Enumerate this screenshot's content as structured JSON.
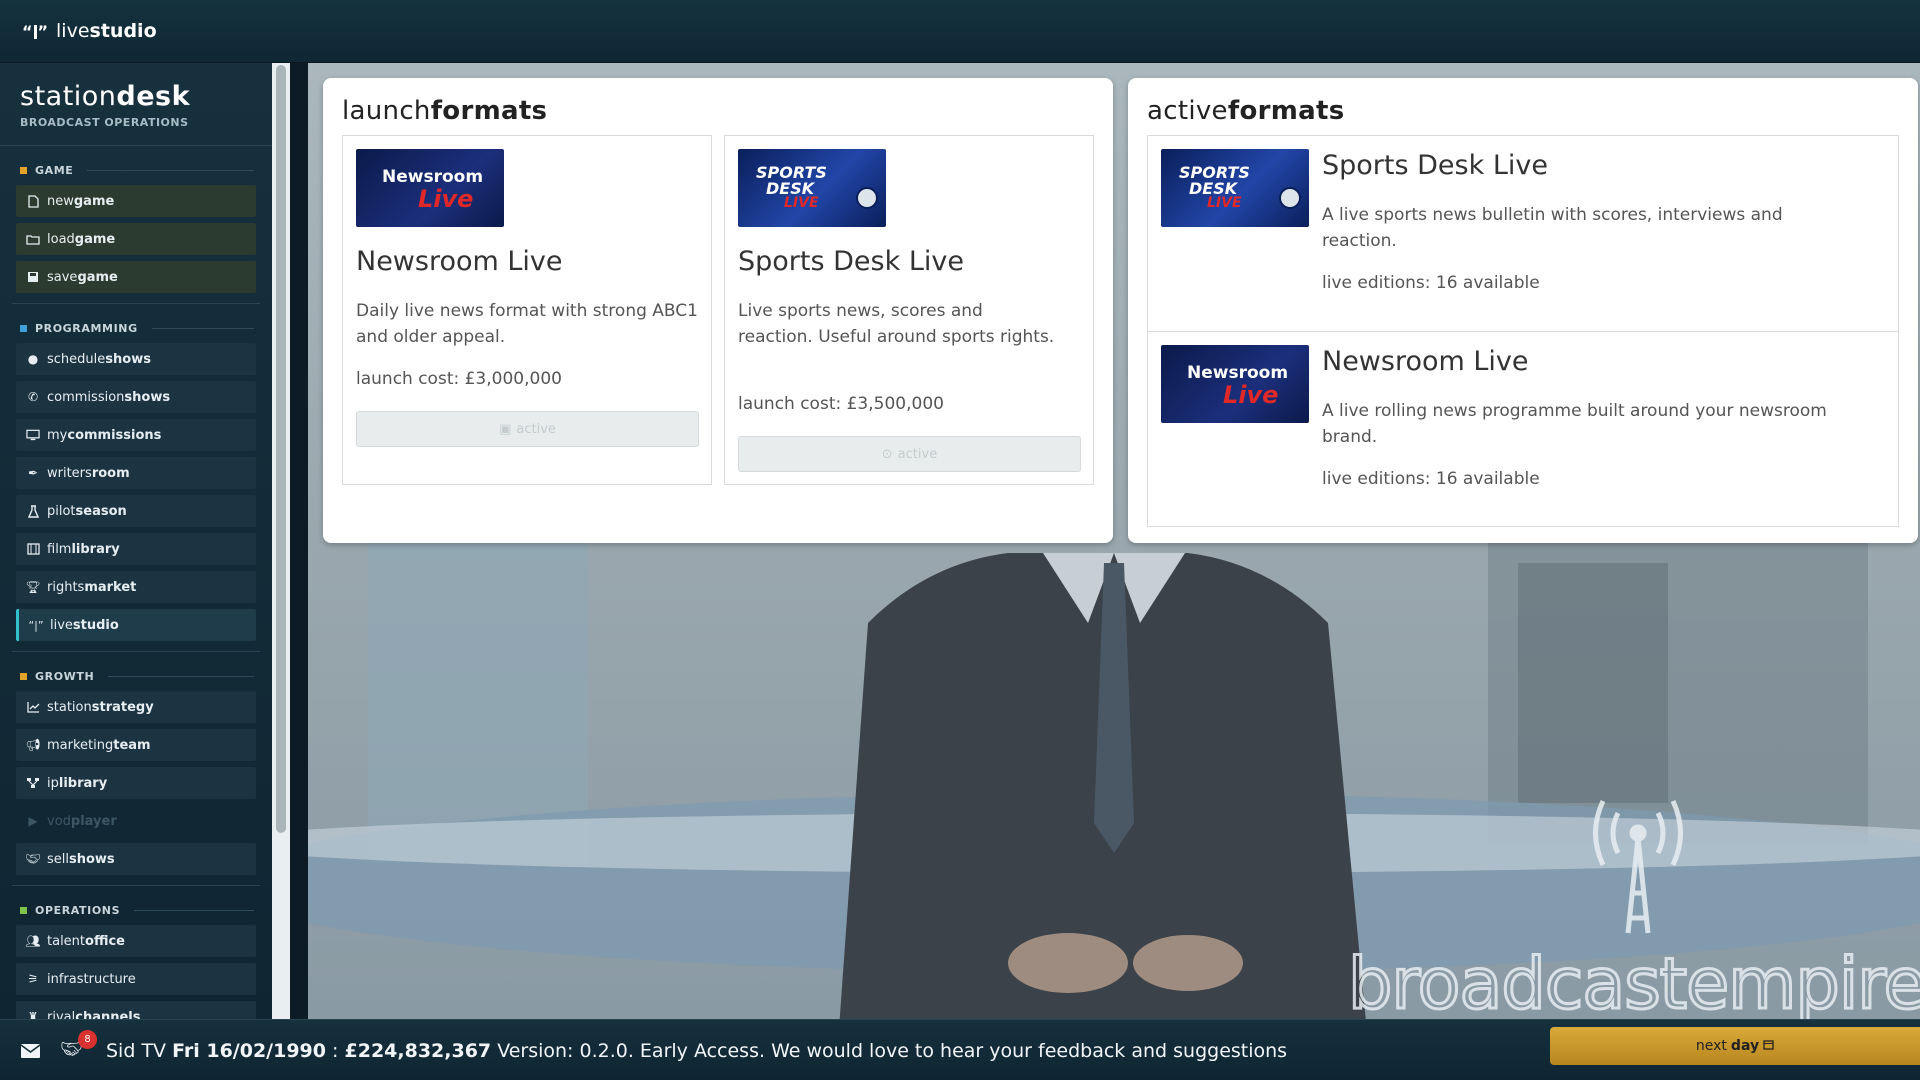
{
  "topbar": {
    "title_light": "live",
    "title_bold": "studio",
    "icon": "antenna-icon"
  },
  "sidebar": {
    "brand_light": "station",
    "brand_bold": "desk",
    "brand_sub": "BROADCAST OPERATIONS",
    "sections": [
      {
        "title": "GAME",
        "color": "#e2a32a",
        "items": [
          {
            "light": "new",
            "bold": "game",
            "icon": "file-icon"
          },
          {
            "light": "load",
            "bold": "game",
            "icon": "folder-icon"
          },
          {
            "light": "save",
            "bold": "game",
            "icon": "floppy-icon"
          }
        ]
      },
      {
        "title": "PROGRAMMING",
        "color": "#3fa0d8",
        "items": [
          {
            "light": "schedule",
            "bold": "shows",
            "icon": "clock-icon"
          },
          {
            "light": "commission",
            "bold": "shows",
            "icon": "phone-icon"
          },
          {
            "light": "my",
            "bold": "commissions",
            "icon": "monitor-icon"
          },
          {
            "light": "writers",
            "bold": "room",
            "icon": "pen-icon"
          },
          {
            "light": "pilot",
            "bold": "season",
            "icon": "flask-icon"
          },
          {
            "light": "film",
            "bold": "library",
            "icon": "film-icon"
          },
          {
            "light": "rights",
            "bold": "market",
            "icon": "trophy-icon"
          },
          {
            "light": "live",
            "bold": "studio",
            "icon": "antenna-icon"
          }
        ]
      },
      {
        "title": "GROWTH",
        "color": "#e2a32a",
        "items": [
          {
            "light": "station",
            "bold": "strategy",
            "icon": "chart-line-icon"
          },
          {
            "light": "marketing",
            "bold": "team",
            "icon": "megaphone-icon"
          },
          {
            "light": "ip",
            "bold": "library",
            "icon": "network-icon"
          },
          {
            "light": "vod",
            "bold": "player",
            "icon": "play-icon"
          },
          {
            "light": "sell",
            "bold": "shows",
            "icon": "handshake-icon"
          }
        ]
      },
      {
        "title": "OPERATIONS",
        "color": "#7ec24a",
        "items": [
          {
            "light": "talent",
            "bold": "office",
            "icon": "users-icon"
          },
          {
            "light": "infrastructure",
            "bold": "",
            "icon": "tower-icon"
          },
          {
            "light": "rival",
            "bold": "channels",
            "icon": "chess-icon"
          }
        ]
      }
    ]
  },
  "launch": {
    "title_light": "launch",
    "title_bold": "formats",
    "formats": [
      {
        "logo_line1": "Newsroom",
        "logo_line2": "Live",
        "name": "Newsroom Live",
        "desc": "Daily live news format with strong ABC1 and older appeal.",
        "cost": "launch cost: £3,000,000",
        "button": "active",
        "button_icon": "image-icon"
      },
      {
        "logo_line1": "SPORTS",
        "logo_line2": "DESK",
        "logo_line3": "LIVE",
        "name": "Sports Desk Live",
        "desc": "Live sports news, scores and reaction. Useful around sports rights.",
        "cost": "launch cost: £3,500,000",
        "button": "active",
        "button_icon": "soccer-ball-icon"
      }
    ]
  },
  "active": {
    "title_light": "active",
    "title_bold": "formats",
    "formats": [
      {
        "logo_line1": "SPORTS",
        "logo_line2": "DESK",
        "logo_line3": "LIVE",
        "name": "Sports Desk Live",
        "desc": "A live sports news bulletin with scores, interviews and reaction.",
        "editions": "live editions: 16 available"
      },
      {
        "logo_line1": "Newsroom",
        "logo_line2": "Live",
        "name": "Newsroom Live",
        "desc": "A live rolling news programme built around your newsroom brand.",
        "editions": "live editions: 16 available"
      }
    ]
  },
  "watermark": {
    "text": "broadcastempire"
  },
  "bottombar": {
    "mail_icon": "envelope-icon",
    "handshake_icon": "handshake-icon",
    "badge": "8",
    "channel": "Sid TV",
    "date": "Fri 16/02/1990",
    "separator": ":",
    "money": "£224,832,367",
    "version": "Version: 0.2.0. Early Access. We would love to hear your feedback and suggestions",
    "next_light": "next",
    "next_bold": "day",
    "next_icon": "calendar-icon"
  }
}
